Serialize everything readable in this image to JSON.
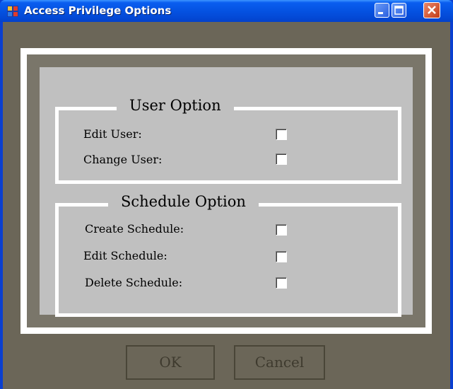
{
  "window": {
    "title": "Access Privilege Options"
  },
  "user_option": {
    "legend": "User Option",
    "items": [
      {
        "label": "Edit User:",
        "checked": false
      },
      {
        "label": "Change User:",
        "checked": false
      }
    ]
  },
  "schedule_option": {
    "legend": "Schedule Option",
    "items": [
      {
        "label": "Create Schedule:",
        "checked": false
      },
      {
        "label": "Edit Schedule:",
        "checked": false
      },
      {
        "label": "Delete Schedule:",
        "checked": false
      }
    ]
  },
  "buttons": {
    "ok": "OK",
    "cancel": "Cancel"
  },
  "colors": {
    "titlebar": "#0554e3",
    "client_bg": "#6b6658",
    "panel_bg": "#c0c0c0",
    "frame": "#ffffff"
  }
}
